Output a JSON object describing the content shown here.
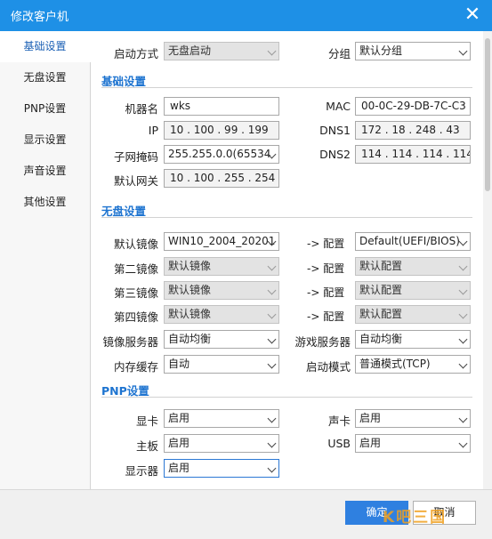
{
  "window": {
    "title": "修改客户机"
  },
  "sidebar": {
    "items": [
      {
        "label": "基础设置"
      },
      {
        "label": "无盘设置"
      },
      {
        "label": "PNP设置"
      },
      {
        "label": "显示设置"
      },
      {
        "label": "声音设置"
      },
      {
        "label": "其他设置"
      }
    ]
  },
  "top": {
    "boot_mode_label": "启动方式",
    "boot_mode_value": "无盘启动",
    "group_label": "分组",
    "group_value": "默认分组"
  },
  "basic": {
    "title": "基础设置",
    "name_label": "机器名",
    "name_value": "wks",
    "mac_label": "MAC",
    "mac_value": "00-0C-29-DB-7C-C3",
    "ip_label": "IP",
    "ip_value": "10 . 100 . 99 . 199",
    "dns1_label": "DNS1",
    "dns1_value": "172 . 18 . 248 . 43",
    "mask_label": "子网掩码",
    "mask_value": "255.255.0.0(65534",
    "dns2_label": "DNS2",
    "dns2_value": "114 . 114 . 114 . 114",
    "gw_label": "默认网关",
    "gw_value": "10 . 100 . 255 . 254"
  },
  "diskless": {
    "title": "无盘设置",
    "arrow": "->  配置",
    "img1_label": "默认镜像",
    "img1_value": "WIN10_2004_20201",
    "cfg1_value": "Default(UEFI/BIOS)",
    "img2_label": "第二镜像",
    "img2_value": "默认镜像",
    "cfg2_value": "默认配置",
    "img3_label": "第三镜像",
    "img3_value": "默认镜像",
    "cfg3_value": "默认配置",
    "img4_label": "第四镜像",
    "img4_value": "默认镜像",
    "cfg4_value": "默认配置",
    "imgsrv_label": "镜像服务器",
    "imgsrv_value": "自动均衡",
    "gamesrv_label": "游戏服务器",
    "gamesrv_value": "自动均衡",
    "cache_label": "内存缓存",
    "cache_value": "自动",
    "bootmode_label": "启动模式",
    "bootmode_value": "普通模式(TCP)"
  },
  "pnp": {
    "title": "PNP设置",
    "gpu_label": "显卡",
    "gpu_value": "启用",
    "sound_label": "声卡",
    "sound_value": "启用",
    "board_label": "主板",
    "board_value": "启用",
    "usb_label": "USB",
    "usb_value": "启用",
    "monitor_label": "显示器",
    "monitor_value": "启用"
  },
  "footer": {
    "ok": "确定",
    "cancel": "取消"
  },
  "watermark": "K吧三国"
}
